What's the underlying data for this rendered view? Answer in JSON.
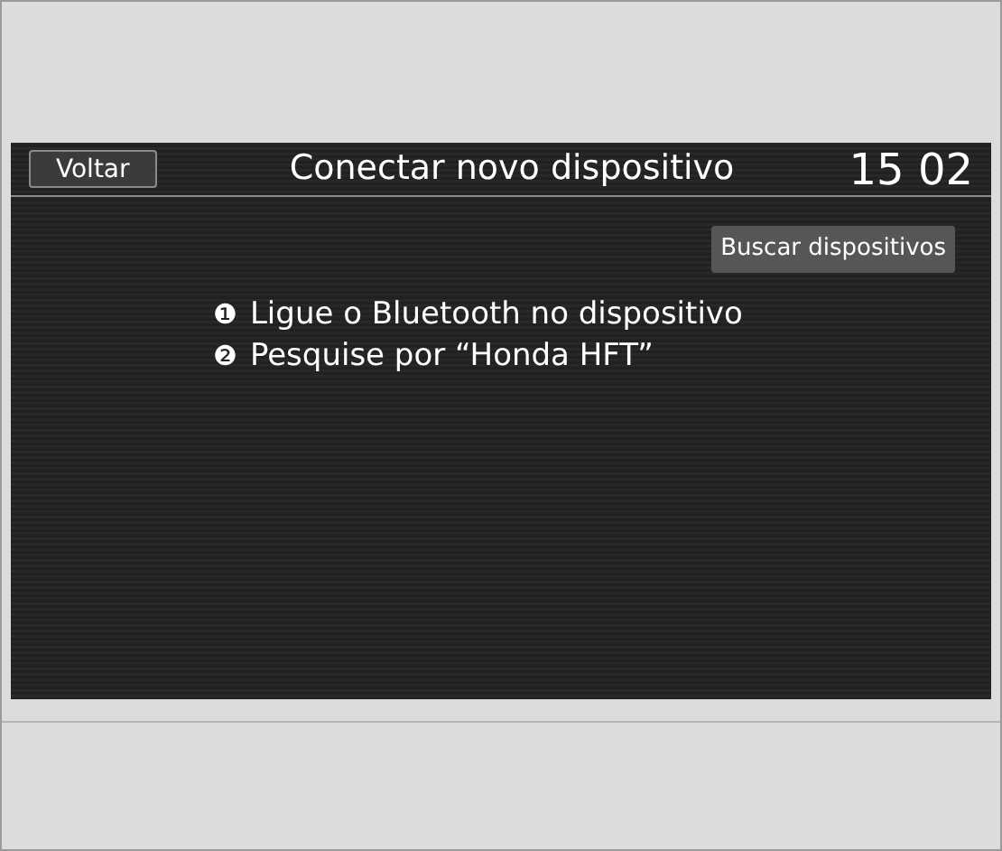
{
  "header": {
    "back_button": "Voltar",
    "title": "Conectar novo dispositivo",
    "clock": "15 02"
  },
  "search_button": "Buscar dispositivos",
  "steps": [
    {
      "marker": "❶",
      "text": "Ligue o Bluetooth no dispositivo"
    },
    {
      "marker": "❷",
      "text": "Pesquise por “Honda HFT”"
    }
  ]
}
